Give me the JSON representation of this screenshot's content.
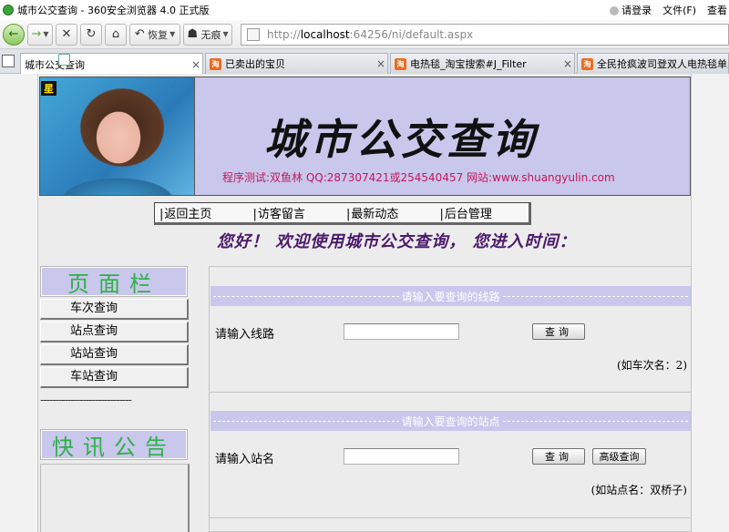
{
  "browser": {
    "window_title": "城市公交查询 - 360安全浏览器 4.0 正式版",
    "login_label": "请登录",
    "menu_file": "文件(F)",
    "menu_view": "查看",
    "back_label": "恢复",
    "no_trace_label": "无痕",
    "address_prefix": "http://",
    "address_host": "localhost",
    "address_rest": ":64256/ni/default.aspx",
    "tabs": [
      {
        "label": "城市公交查询",
        "active": true
      },
      {
        "label": "已卖出的宝贝",
        "active": false
      },
      {
        "label": "电热毯_淘宝搜索#J_Filter",
        "active": false
      },
      {
        "label": "全民抢疯波司登双人电热毯单人电",
        "active": false
      }
    ]
  },
  "page": {
    "photo_badge": "星",
    "banner_title": "城市公交查询",
    "banner_contact": "程序测试:双鱼林 QQ:287307421或254540457 网站:www.shuangyulin.com",
    "nav": [
      "返回主页",
      "访客留言",
      "最新动态",
      "后台管理"
    ],
    "marquee": "您好！ 欢迎使用城市公交查询， 您进入时间：",
    "sidebar": {
      "title": "页面栏",
      "items": [
        "车次查询",
        "站点查询",
        "站站查询",
        "车站查询"
      ],
      "separator": "------------------------------",
      "notice_title": "快讯公告"
    },
    "route_query": {
      "header": "请输入要查询的线路",
      "label": "请输入线路",
      "value": "",
      "button": "查询",
      "hint": "(如车次名：2)"
    },
    "station_query": {
      "header": "请输入要查询的站点",
      "label": "请输入站名",
      "value": "",
      "button": "查询",
      "adv_button": "高级查询",
      "hint": "(如站点名：双桥子)"
    }
  },
  "colors": {
    "banner_bg": "#c9c7ec",
    "panel_title": "#2fb04a",
    "contact_text": "#c2185b",
    "marquee_text": "#4b1a6a"
  }
}
